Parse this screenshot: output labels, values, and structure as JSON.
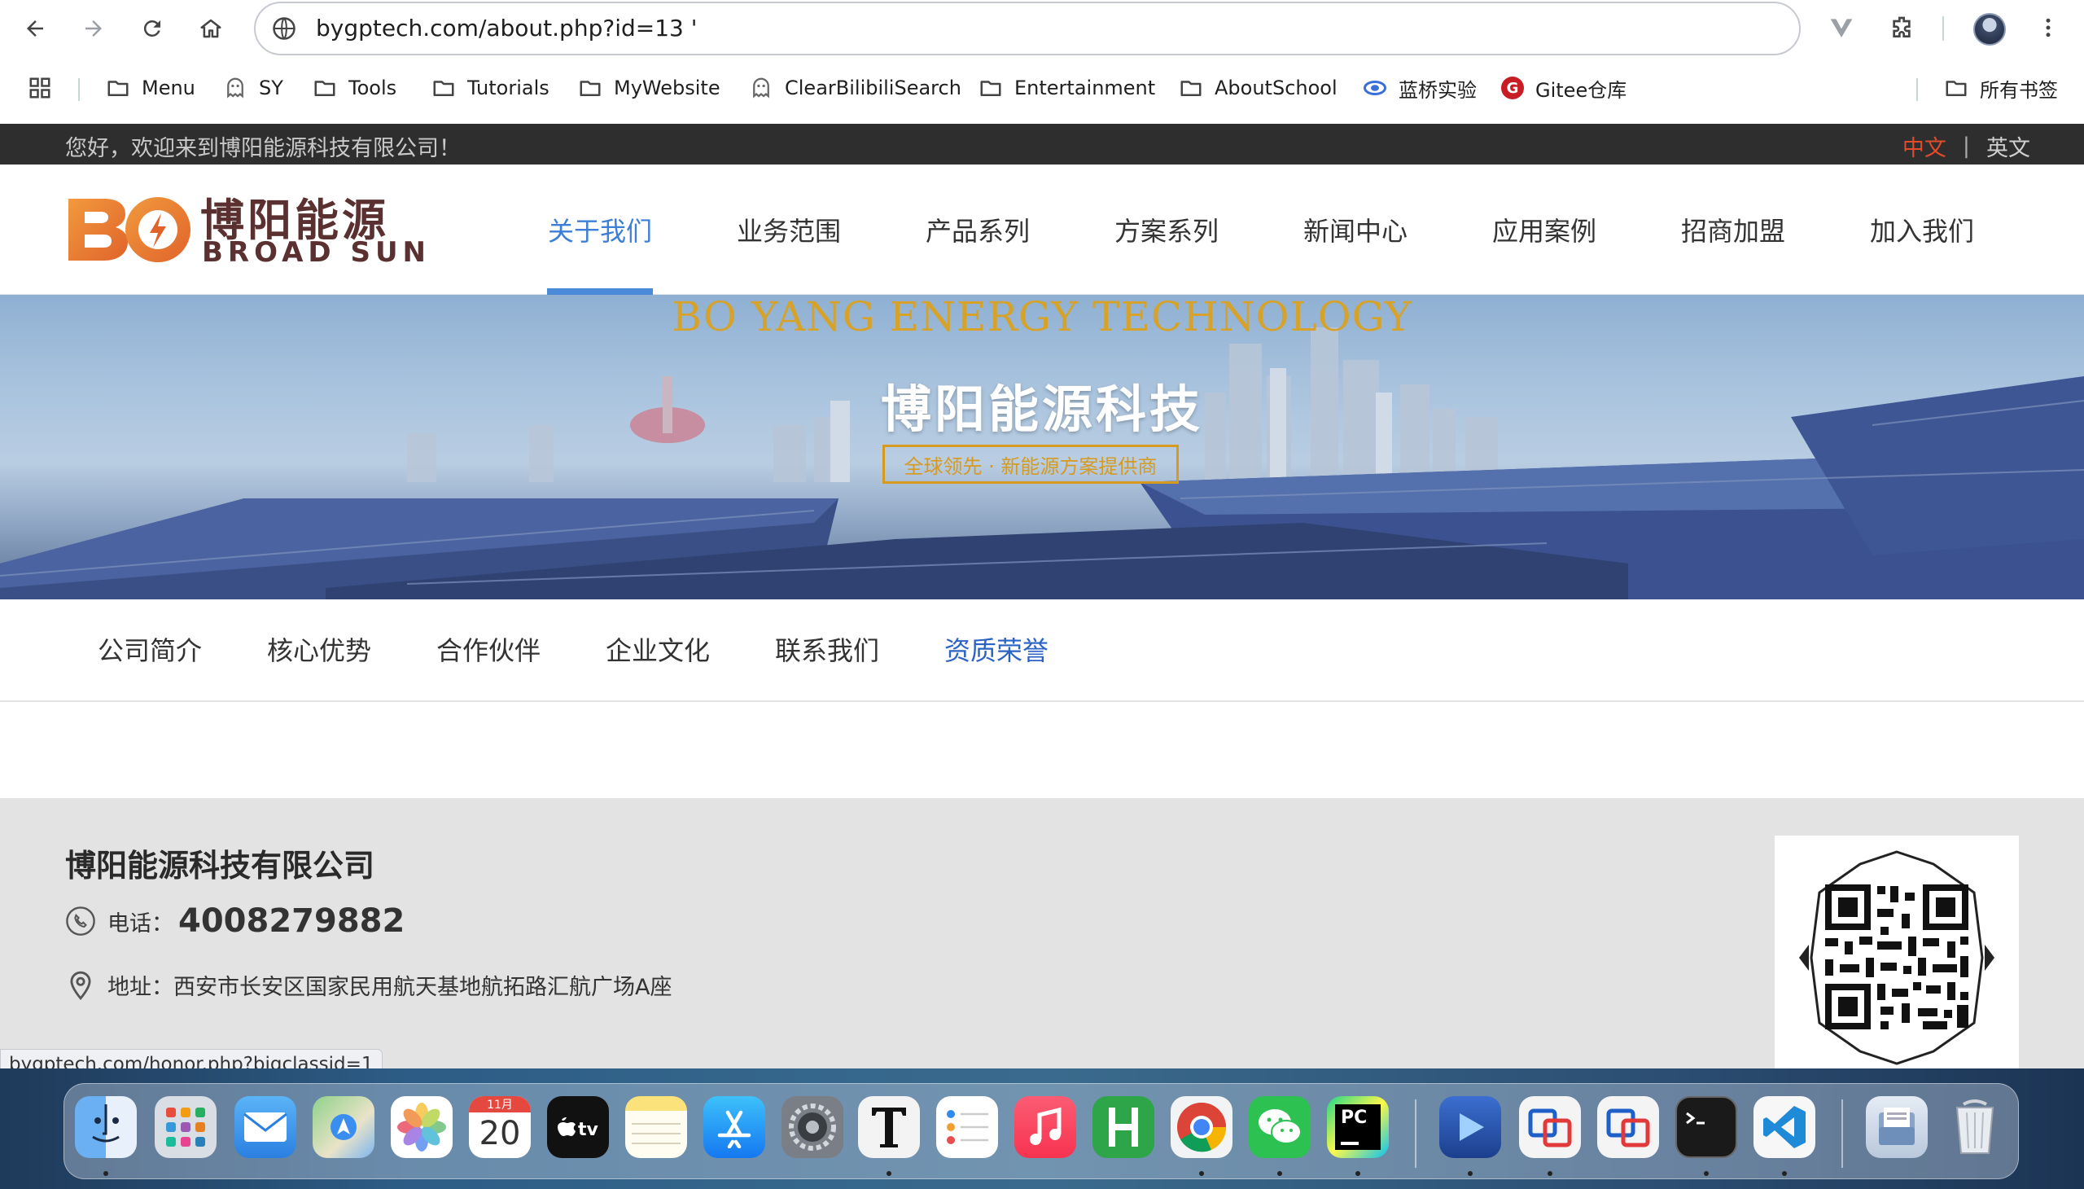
{
  "browser": {
    "url": "bygptech.com/about.php?id=13 '",
    "bookmarks": [
      {
        "label": "Menu",
        "icon": "folder-icon"
      },
      {
        "label": "SY",
        "icon": "ghost-icon"
      },
      {
        "label": "Tools",
        "icon": "folder-icon"
      },
      {
        "label": "Tutorials",
        "icon": "folder-icon"
      },
      {
        "label": "MyWebsite",
        "icon": "folder-icon"
      },
      {
        "label": "ClearBilibiliSearch",
        "icon": "ghost-icon"
      },
      {
        "label": "Entertainment",
        "icon": "folder-icon"
      },
      {
        "label": "AboutSchool",
        "icon": "folder-icon"
      },
      {
        "label": "蓝桥实验",
        "icon": "lanqiao-icon"
      },
      {
        "label": "Gitee仓库",
        "icon": "gitee-icon"
      }
    ],
    "all_bookmarks": "所有书签",
    "status_url": "bygptech.com/honor.php?bigclassid=1"
  },
  "site": {
    "welcome": "您好，欢迎来到博阳能源科技有限公司！",
    "lang_zh": "中文",
    "lang_sep": "|",
    "lang_en": "英文",
    "logo_cn": "博阳能源",
    "logo_en": "BROAD SUN",
    "nav": [
      "关于我们",
      "业务范围",
      "产品系列",
      "方案系列",
      "新闻中心",
      "应用案例",
      "招商加盟",
      "加入我们"
    ],
    "banner": {
      "en_title": "BO YANG ENERGY TECHNOLOGY",
      "cn_title": "博阳能源科技",
      "tagline": "全球领先 · 新能源方案提供商"
    },
    "subnav": [
      "公司简介",
      "核心优势",
      "合作伙伴",
      "企业文化",
      "联系我们",
      "资质荣誉"
    ],
    "footer": {
      "company": "博阳能源科技有限公司",
      "phone_label": "电话：",
      "phone": "4008279882",
      "address_label": "地址：",
      "address": "西安市长安区国家民用航天基地航拓路汇航广场A座"
    }
  },
  "dock": {
    "calendar_month": "11月",
    "calendar_day": "20"
  },
  "colors": {
    "accent": "#3d7fd6",
    "active_subnav": "#2b63c4",
    "topbar": "#2e2e2e",
    "lang_active": "#e34b2a",
    "banner_gold": "#d69a1f",
    "logo_orange": "#e8792a"
  }
}
